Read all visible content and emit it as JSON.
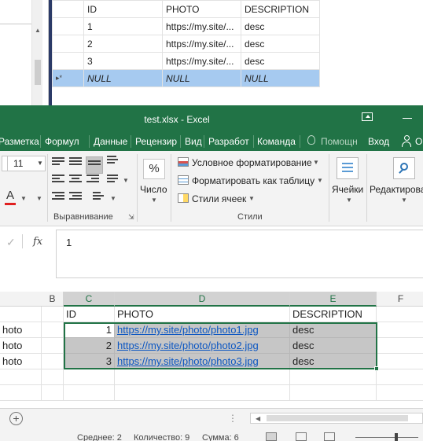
{
  "ssms": {
    "columns": [
      "ID",
      "PHOTO",
      "DESCRIPTION"
    ],
    "rows": [
      {
        "id": "1",
        "photo": "https://my.site/...",
        "desc": "desc"
      },
      {
        "id": "2",
        "photo": "https://my.site/...",
        "desc": "desc"
      },
      {
        "id": "3",
        "photo": "https://my.site/...",
        "desc": "desc"
      }
    ],
    "null_row": {
      "marker": "▸*",
      "id": "NULL",
      "photo": "NULL",
      "desc": "NULL"
    }
  },
  "excel": {
    "title": "test.xlsx - Excel",
    "tabs": [
      "Разметка",
      "Формул",
      "Данные",
      "Рецензир",
      "Вид",
      "Разработ",
      "Команда"
    ],
    "tell_me": "Помощн",
    "sign_in": "Вход",
    "share_partial": "О",
    "ribbon": {
      "font_size": "11",
      "font_color_letter": "A",
      "align_group_label": "Выравнивание",
      "number_label": "Число",
      "percent_symbol": "%",
      "styles": {
        "conditional": "Условное форматирование",
        "format_table": "Форматировать как таблицу",
        "cell_styles": "Стили ячеек",
        "group_label": "Стили"
      },
      "cells_label": "Ячейки",
      "editing_label": "Редактирова"
    },
    "formula_bar": {
      "check": "✓",
      "fx": "fx",
      "value": "1"
    },
    "columns": [
      "B",
      "C",
      "D",
      "E",
      "F"
    ],
    "header_row": {
      "c": "ID",
      "d": "PHOTO",
      "e": "DESCRIPTION"
    },
    "rows": [
      {
        "a": "hoto",
        "c": "1",
        "d": "https://my.site/photo/photo1.jpg",
        "e": "desc"
      },
      {
        "a": "hoto",
        "c": "2",
        "d": "https://my.site/photo/photo2.jpg",
        "e": "desc"
      },
      {
        "a": "hoto",
        "c": "3",
        "d": "https://my.site/photo/photo3.jpg",
        "e": "desc"
      }
    ],
    "status": {
      "average": "Среднее: 2",
      "count": "Количество: 9",
      "sum": "Сумма: 6"
    }
  }
}
